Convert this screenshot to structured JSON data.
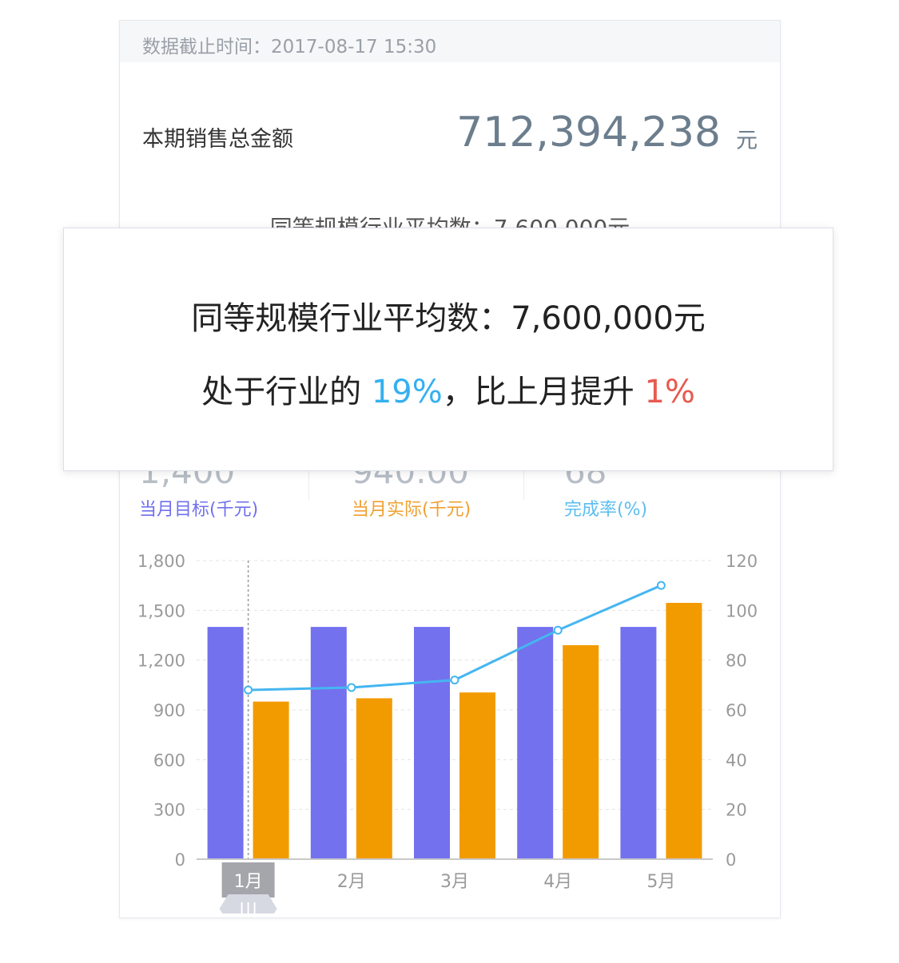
{
  "header": {
    "timestamp": "数据截止时间：2017-08-17  15:30"
  },
  "summary": {
    "total_label": "本期销售总金额",
    "total_value": "712,394,238",
    "total_unit": "元",
    "industry_line": "同等规模行业平均数：7,600,000元"
  },
  "kpis": {
    "items": [
      {
        "label": "当月目标(千元)",
        "value": "1,400",
        "color": "#7070ee"
      },
      {
        "label": "当月实际(千元)",
        "value": "940.00",
        "color": "#f0a030"
      },
      {
        "label": "完成率(%)",
        "value": "68",
        "color": "#5bbef0"
      }
    ]
  },
  "popover": {
    "line1": "同等规模行业平均数：7,600,000元",
    "line2_prefix": "处于行业的 ",
    "percentile": "19%",
    "line2_middle": "，比上月提升 ",
    "change": "1%",
    "percentile_color": "#35b0f0",
    "change_color": "#e85a4f"
  },
  "chart_data": {
    "type": "bar",
    "categories": [
      "1月",
      "2月",
      "3月",
      "4月",
      "5月"
    ],
    "series": [
      {
        "name": "当月目标(千元)",
        "type": "bar",
        "axis": "left",
        "color": "#7371ee",
        "values": [
          1400,
          1400,
          1400,
          1400,
          1400
        ]
      },
      {
        "name": "当月实际(千元)",
        "type": "bar",
        "axis": "left",
        "color": "#f29b00",
        "values": [
          950,
          970,
          1005,
          1290,
          1545
        ]
      },
      {
        "name": "完成率(%)",
        "type": "line",
        "axis": "right",
        "color": "#45b6f0",
        "values": [
          68,
          69,
          72,
          92,
          110
        ]
      }
    ],
    "y_left": {
      "min": 0,
      "max": 1800,
      "ticks": [
        "0",
        "300",
        "600",
        "900",
        "1,200",
        "1,500",
        "1,800"
      ]
    },
    "y_right": {
      "min": 0,
      "max": 120,
      "ticks": [
        "0",
        "20",
        "40",
        "60",
        "80",
        "100",
        "120"
      ]
    },
    "selected_category": "1月",
    "grid": true
  }
}
